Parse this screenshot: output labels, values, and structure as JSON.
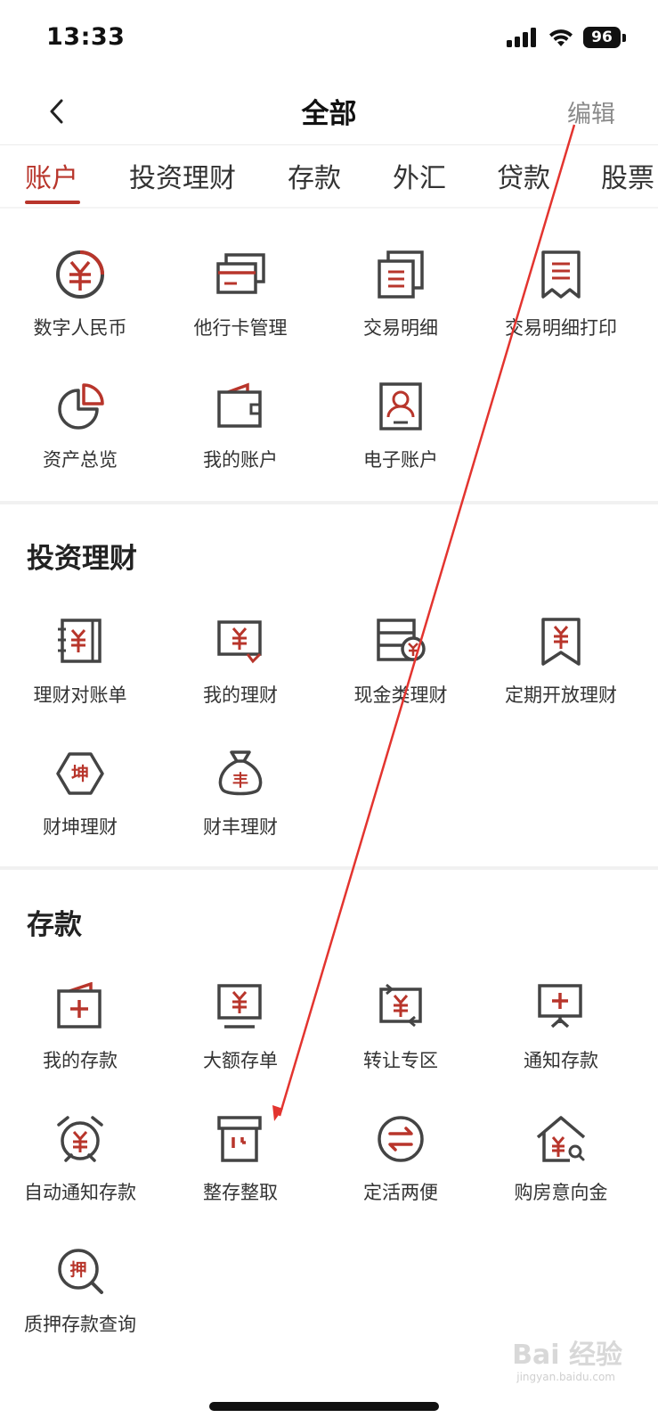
{
  "status_bar": {
    "time": "13:33",
    "battery": "96"
  },
  "nav": {
    "title": "全部",
    "edit_label": "编辑"
  },
  "tabs": [
    {
      "label": "账户",
      "active": true
    },
    {
      "label": "投资理财"
    },
    {
      "label": "存款"
    },
    {
      "label": "外汇"
    },
    {
      "label": "贷款"
    },
    {
      "label": "股票"
    }
  ],
  "accounts": {
    "items": [
      {
        "label": "数字人民币",
        "icon": "digital-rmb-icon"
      },
      {
        "label": "他行卡管理",
        "icon": "cards-icon"
      },
      {
        "label": "交易明细",
        "icon": "transaction-detail-icon"
      },
      {
        "label": "交易明细打印",
        "icon": "receipt-print-icon"
      },
      {
        "label": "资产总览",
        "icon": "pie-chart-icon"
      },
      {
        "label": "我的账户",
        "icon": "wallet-icon"
      },
      {
        "label": "电子账户",
        "icon": "id-card-icon"
      }
    ]
  },
  "investment": {
    "title": "投资理财",
    "items": [
      {
        "label": "理财对账单",
        "icon": "statement-book-icon"
      },
      {
        "label": "我的理财",
        "icon": "my-finance-icon"
      },
      {
        "label": "现金类理财",
        "icon": "cash-finance-icon"
      },
      {
        "label": "定期开放理财",
        "icon": "bookmark-yuan-icon"
      },
      {
        "label": "财坤理财",
        "icon": "hexagon-kun-icon",
        "glyph": "坤"
      },
      {
        "label": "财丰理财",
        "icon": "money-bag-icon",
        "glyph": "丰"
      }
    ]
  },
  "deposit": {
    "title": "存款",
    "items": [
      {
        "label": "我的存款",
        "icon": "deposit-box-icon"
      },
      {
        "label": "大额存单",
        "icon": "monitor-yuan-icon"
      },
      {
        "label": "转让专区",
        "icon": "transfer-yuan-icon"
      },
      {
        "label": "通知存款",
        "icon": "notice-board-icon"
      },
      {
        "label": "自动通知存款",
        "icon": "alarm-clock-icon"
      },
      {
        "label": "整存整取",
        "icon": "archive-box-icon"
      },
      {
        "label": "定活两便",
        "icon": "exchange-circle-icon"
      },
      {
        "label": "购房意向金",
        "icon": "house-yuan-icon"
      },
      {
        "label": "质押存款查询",
        "icon": "pledge-search-icon",
        "glyph": "押"
      }
    ]
  },
  "watermark": {
    "text": "Bai 经验",
    "sub": "jingyan.baidu.com"
  },
  "colors": {
    "accent": "#b8352b",
    "icon_gray": "#444444",
    "annotation": "#e3342f"
  }
}
